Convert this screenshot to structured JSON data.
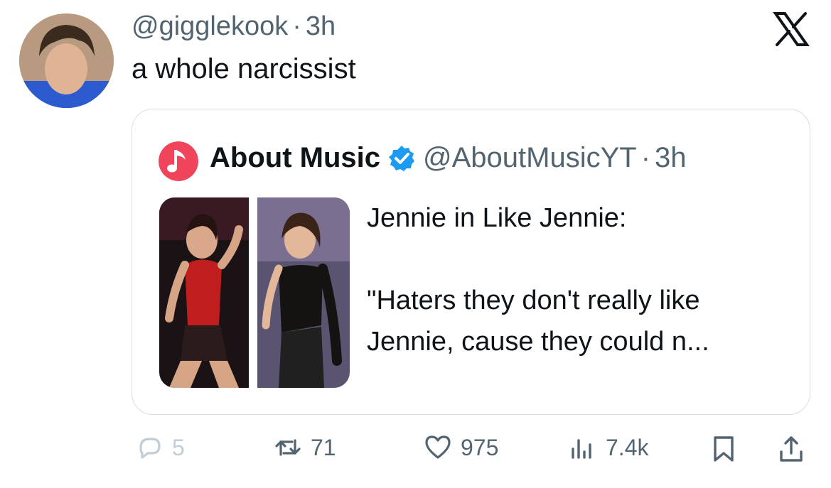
{
  "tweet": {
    "handle": "@gigglekook",
    "separator": "·",
    "time": "3h",
    "text": "a whole narcissist"
  },
  "quote": {
    "name": "About Music",
    "handle": "@AboutMusicYT",
    "separator": "·",
    "time": "3h",
    "text_lines": [
      "Jennie in Like Jennie:",
      "",
      "\"Haters they don't really like",
      "Jennie,  cause they could n..."
    ]
  },
  "actions": {
    "replies": "5",
    "reposts": "71",
    "likes": "975",
    "views": "7.4k"
  },
  "icons": {
    "reply": "reply-icon",
    "repost": "repost-icon",
    "like": "heart-icon",
    "views": "views-icon",
    "bookmark": "bookmark-icon",
    "share": "share-icon",
    "brand": "x-logo-icon",
    "verified": "verified-badge-icon"
  },
  "colors": {
    "text_primary": "#0f1419",
    "text_secondary": "#536471",
    "verified_blue": "#1d9bf0",
    "music_red": "#f0445a"
  }
}
